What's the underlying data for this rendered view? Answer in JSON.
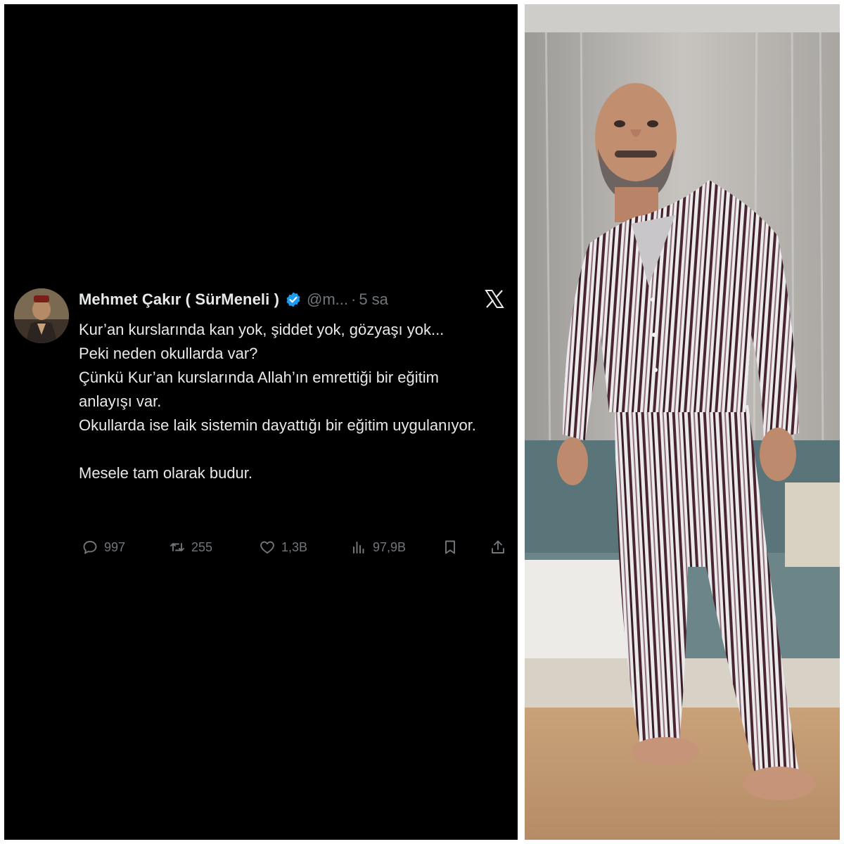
{
  "tweet": {
    "display_name": "Mehmet Çakır ( SürMeneli )",
    "handle": "@m...",
    "separator": "·",
    "time": "5 sa",
    "paragraphs": [
      "Kur’an kurslarında kan yok, şiddet yok, gözyaşı yok...",
      "Peki neden okullarda var?",
      "Çünkü Kur’an kurslarında Allah’ın emrettiği bir eğitim anlayışı var.",
      "Okullarda ise laik sistemin dayattığı bir eğitim uygulanıyor.",
      "Mesele tam olarak budur."
    ],
    "stats": {
      "replies": "997",
      "retweets": "255",
      "likes": "1,3B",
      "views": "97,9B"
    },
    "icons": [
      "reply-icon",
      "retweet-icon",
      "like-icon",
      "views-icon",
      "bookmark-icon",
      "share-icon",
      "verified-badge-icon",
      "x-logo-icon"
    ]
  },
  "colors": {
    "background": "#000000",
    "text_primary": "#e7e9ea",
    "text_secondary": "#71767b",
    "verified_blue": "#1d9bf0"
  }
}
